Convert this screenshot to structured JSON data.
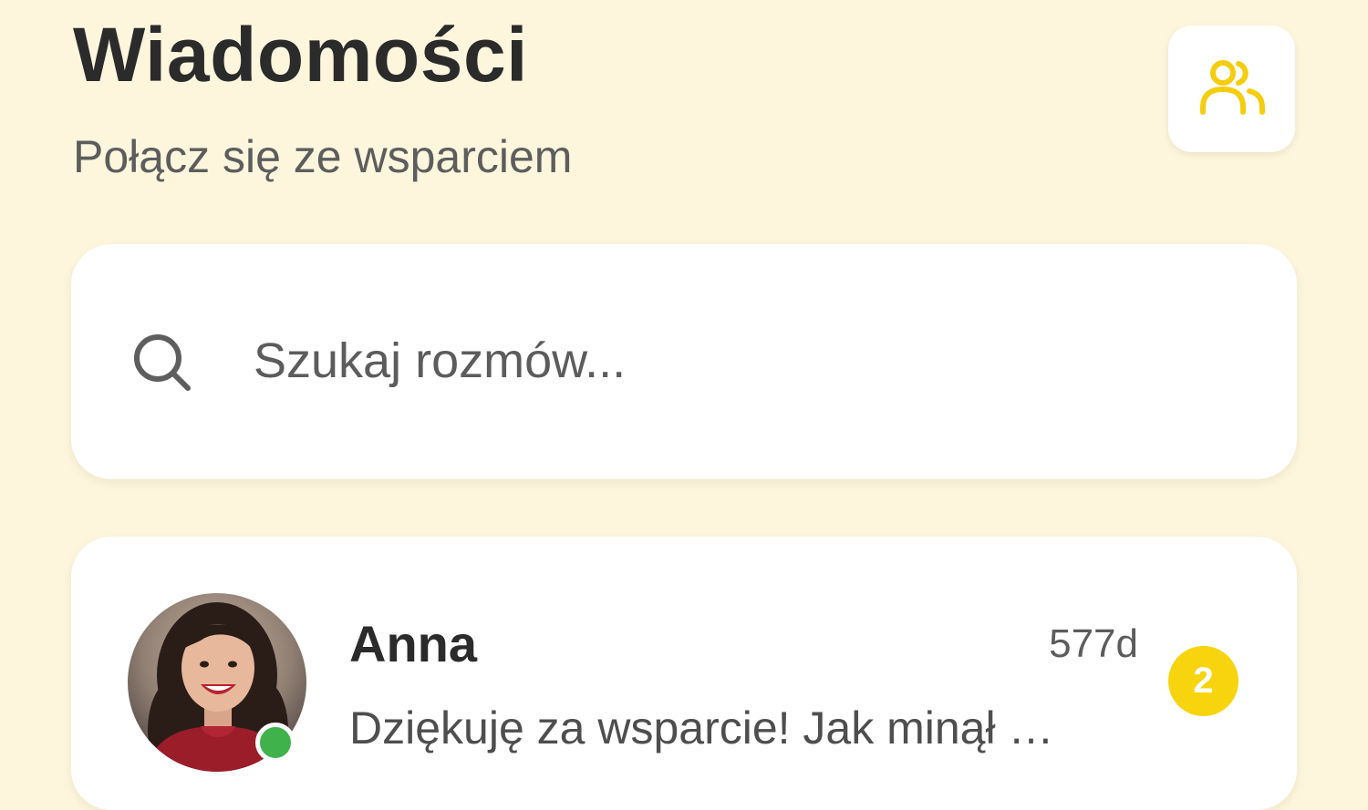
{
  "header": {
    "title": "Wiadomości",
    "subtitle": "Połącz się ze wsparciem",
    "contacts_icon": "users-icon",
    "accent_color": "#f5cd0f"
  },
  "search": {
    "placeholder": "Szukaj rozmów...",
    "value": "",
    "icon": "search-icon"
  },
  "conversations": [
    {
      "name": "Anna",
      "time": "577d",
      "preview": "Dziękuję za wsparcie! Jak minął …",
      "unread": "2",
      "online": true,
      "status_color": "#3fb24c"
    }
  ]
}
